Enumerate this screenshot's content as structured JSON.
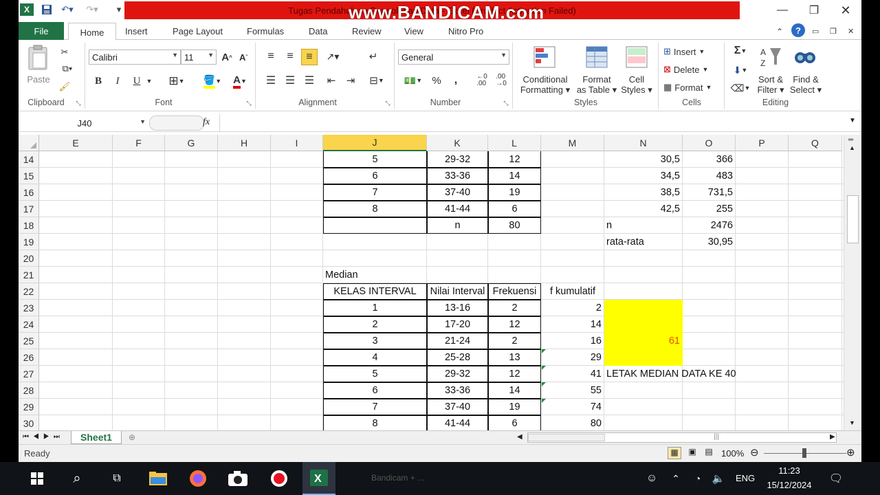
{
  "title": {
    "text": "Tugas Pendahuluan Pengolahan Data - Excel (Product Activation Failed)",
    "watermark": "www.BANDICAM.com"
  },
  "tabs": [
    "File",
    "Home",
    "Insert",
    "Page Layout",
    "Formulas",
    "Data",
    "Review",
    "View",
    "Nitro Pro"
  ],
  "ribbon": {
    "clipboard": {
      "paste": "Paste",
      "label": "Clipboard"
    },
    "font": {
      "name": "Calibri",
      "size": "11",
      "label": "Font",
      "bold": "B",
      "italic": "I",
      "underline": "U"
    },
    "alignment": {
      "label": "Alignment"
    },
    "number": {
      "format": "General",
      "label": "Number",
      "percent": "%",
      "comma": ","
    },
    "styles": {
      "conditional_1": "Conditional",
      "conditional_2": "Formatting",
      "format_table_1": "Format",
      "format_table_2": "as Table",
      "cell_styles_1": "Cell",
      "cell_styles_2": "Styles",
      "label": "Styles"
    },
    "cells": {
      "insert": "Insert",
      "delete": "Delete",
      "format": "Format",
      "label": "Cells"
    },
    "editing": {
      "sort_1": "Sort &",
      "sort_2": "Filter",
      "find_1": "Find &",
      "find_2": "Select",
      "label": "Editing",
      "sigma": "Σ"
    }
  },
  "formula_bar": {
    "name_box": "J40",
    "fx": "fx",
    "formula": ""
  },
  "columns": [
    "E",
    "F",
    "G",
    "H",
    "I",
    "J",
    "K",
    "L",
    "M",
    "N",
    "O",
    "P",
    "Q"
  ],
  "selected_column": "J",
  "rows": [
    "14",
    "15",
    "16",
    "17",
    "18",
    "19",
    "20",
    "21",
    "22",
    "23",
    "24",
    "25",
    "26",
    "27",
    "28",
    "29",
    "30"
  ],
  "table1": [
    {
      "kelas": "5",
      "interval": "29-32",
      "f": "12",
      "xi": "30,5",
      "fx": "366"
    },
    {
      "kelas": "6",
      "interval": "33-36",
      "f": "14",
      "xi": "34,5",
      "fx": "483"
    },
    {
      "kelas": "7",
      "interval": "37-40",
      "f": "19",
      "xi": "38,5",
      "fx": "731,5"
    },
    {
      "kelas": "8",
      "interval": "41-44",
      "f": "6",
      "xi": "42,5",
      "fx": "255"
    }
  ],
  "table1_total": {
    "n_label": "n",
    "n_value": "80",
    "n2_label": "n",
    "sum_fx": "2476"
  },
  "mean": {
    "label": "rata-rata",
    "value": "30,95"
  },
  "median": {
    "title": "Median",
    "headers": [
      "KELAS INTERVAL",
      "Nilai Interval",
      "Frekuensi",
      "f kumulatif"
    ],
    "rows": [
      {
        "kelas": "1",
        "interval": "13-16",
        "f": "2",
        "fk": "2"
      },
      {
        "kelas": "2",
        "interval": "17-20",
        "f": "12",
        "fk": "14"
      },
      {
        "kelas": "3",
        "interval": "21-24",
        "f": "2",
        "fk": "16"
      },
      {
        "kelas": "4",
        "interval": "25-28",
        "f": "13",
        "fk": "29"
      },
      {
        "kelas": "5",
        "interval": "29-32",
        "f": "12",
        "fk": "41"
      },
      {
        "kelas": "6",
        "interval": "33-36",
        "f": "14",
        "fk": "55"
      },
      {
        "kelas": "7",
        "interval": "37-40",
        "f": "19",
        "fk": "74"
      },
      {
        "kelas": "8",
        "interval": "41-44",
        "f": "6",
        "fk": "80"
      }
    ],
    "highlight_value": "61",
    "note": "LETAK MEDIAN DATA KE 40"
  },
  "sheet_tab": "Sheet1",
  "status": {
    "ready": "Ready",
    "zoom": "100%"
  },
  "taskbar": {
    "time": "11:23",
    "date": "15/12/2024",
    "lang": "ENG",
    "bg_text": "Bandicam + ..."
  },
  "colors": {
    "excel_green": "#217346",
    "highlight_yellow": "#ffff00",
    "banner_red": "#e0140f",
    "selected_header": "#f9d44c"
  }
}
